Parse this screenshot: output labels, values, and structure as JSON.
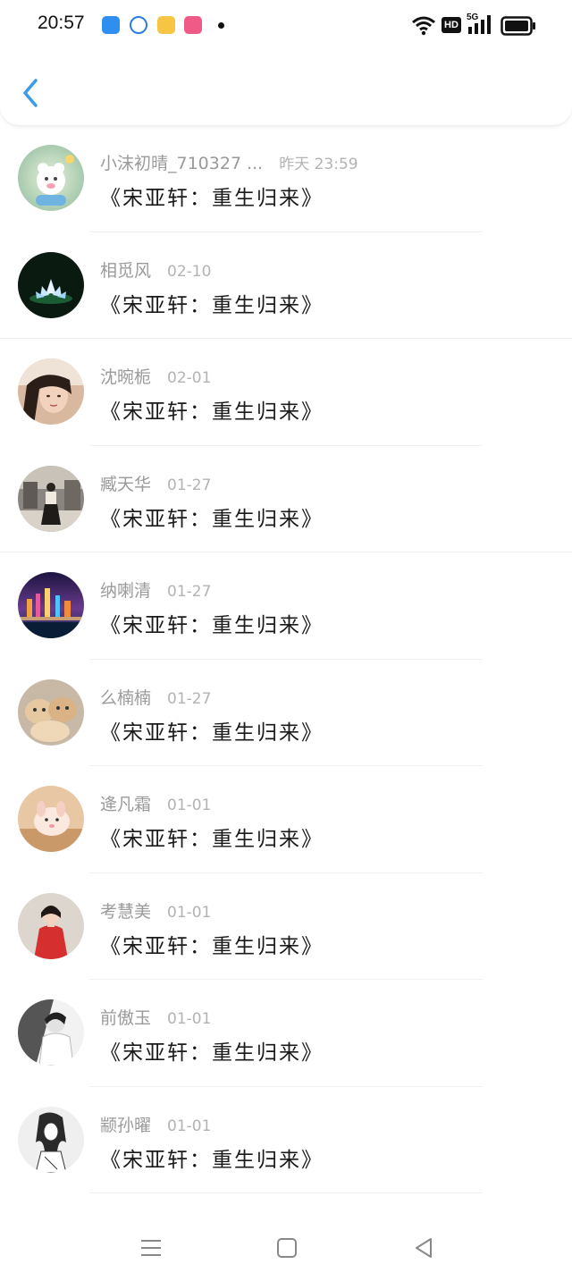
{
  "status_bar": {
    "time": "20:57",
    "app_icons": [
      "blue-app-icon",
      "browser-icon",
      "notes-app-icon",
      "bilibili-icon"
    ],
    "network": "5G",
    "hd_label": "HD"
  },
  "header": {
    "back_icon": "chevron-left-icon"
  },
  "messages": [
    {
      "name": "小沫初晴_710327 ...",
      "time": "昨天 23:59",
      "title": "《宋亚轩：重生归来》"
    },
    {
      "name": "相觅风",
      "time": "02-10",
      "title": "《宋亚轩：重生归来》"
    },
    {
      "name": "沈晼栀",
      "time": "02-01",
      "title": "《宋亚轩：重生归来》"
    },
    {
      "name": "臧天华",
      "time": "01-27",
      "title": "《宋亚轩：重生归来》"
    },
    {
      "name": "纳喇清",
      "time": "01-27",
      "title": "《宋亚轩：重生归来》"
    },
    {
      "name": "么楠楠",
      "time": "01-27",
      "title": "《宋亚轩：重生归来》"
    },
    {
      "name": "逄凡霜",
      "time": "01-01",
      "title": "《宋亚轩：重生归来》"
    },
    {
      "name": "考慧美",
      "time": "01-01",
      "title": "《宋亚轩：重生归来》"
    },
    {
      "name": "前傲玉",
      "time": "01-01",
      "title": "《宋亚轩：重生归来》"
    },
    {
      "name": "颛孙曜",
      "time": "01-01",
      "title": "《宋亚轩：重生归来》"
    }
  ],
  "nav_bar": {
    "icons": [
      "menu-icon",
      "home-icon",
      "back-triangle-icon"
    ]
  },
  "colors": {
    "accent": "#3a9be8",
    "name_gray": "#9a9a9a",
    "title_dark": "#1a1a1a"
  }
}
